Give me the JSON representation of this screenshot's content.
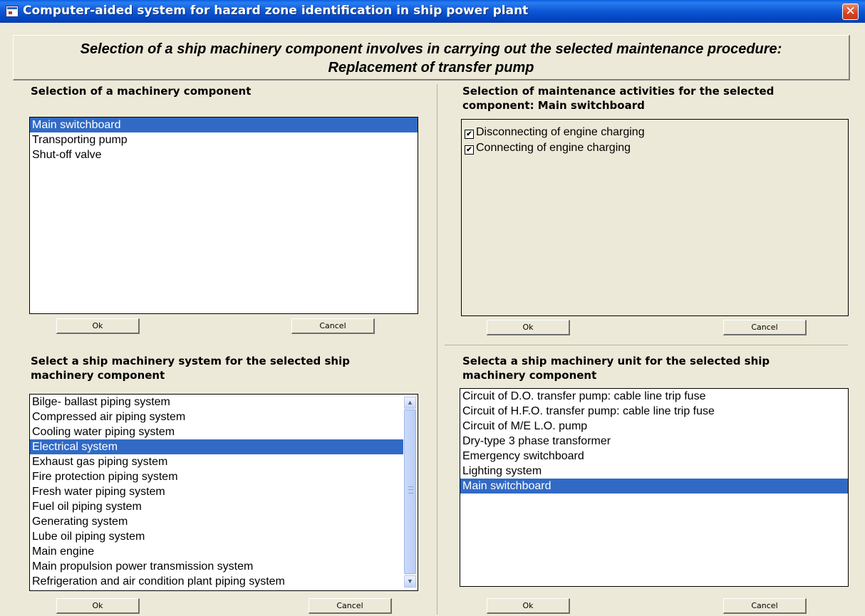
{
  "window": {
    "title": "Computer-aided system for hazard zone identification in ship power plant",
    "close_glyph": "✕"
  },
  "header": {
    "line1": "Selection of a ship machinery component involves in carrying out the selected maintenance procedure:",
    "line2": "Replacement of transfer pump"
  },
  "component_panel": {
    "heading": "Selection of a machinery component",
    "items": [
      "Main switchboard",
      "Transporting pump",
      "Shut-off valve"
    ],
    "selected": "Main switchboard",
    "ok_label": "Ok",
    "cancel_label": "Cancel"
  },
  "activities_panel": {
    "heading_line1": "Selection of maintenance activities for the selected",
    "heading_line2": "component: Main switchboard",
    "items": [
      {
        "label": "Disconnecting of engine charging",
        "checked": true
      },
      {
        "label": "Connecting of engine charging",
        "checked": true
      }
    ],
    "ok_label": "Ok",
    "cancel_label": "Cancel"
  },
  "system_panel": {
    "heading_line1": "Select a ship machinery system for the selected ship",
    "heading_line2": "machinery component",
    "items": [
      "Bilge- ballast piping system",
      "Compressed air piping system",
      "Cooling water piping system",
      "Electrical system",
      "Exhaust gas piping system",
      "Fire protection piping system",
      "Fresh water piping system",
      "Fuel oil piping system",
      "Generating system",
      "Lube oil piping system",
      "Main engine",
      "Main propulsion power transmission system",
      "Refrigeration and air condition plant piping system"
    ],
    "selected": "Electrical system",
    "ok_label": "Ok",
    "cancel_label": "Cancel"
  },
  "unit_panel": {
    "heading_line1": "Selecta a ship machinery unit for the selected ship",
    "heading_line2": "machinery component",
    "items": [
      "Circuit of D.O. transfer pump: cable line trip fuse",
      "Circuit of H.F.O. transfer pump: cable line trip fuse",
      "Circuit of M/E L.O. pump",
      "Dry-type 3 phase transformer",
      "Emergency switchboard",
      "Lighting system",
      "Main switchboard"
    ],
    "selected": "Main switchboard",
    "ok_label": "Ok",
    "cancel_label": "Cancel"
  },
  "icons": {
    "scroll_up": "▲",
    "scroll_down": "▼",
    "check": "✔"
  },
  "colors": {
    "selection": "#316ac5",
    "titlebar": "#0a5fe0",
    "background": "#ece9d8"
  }
}
